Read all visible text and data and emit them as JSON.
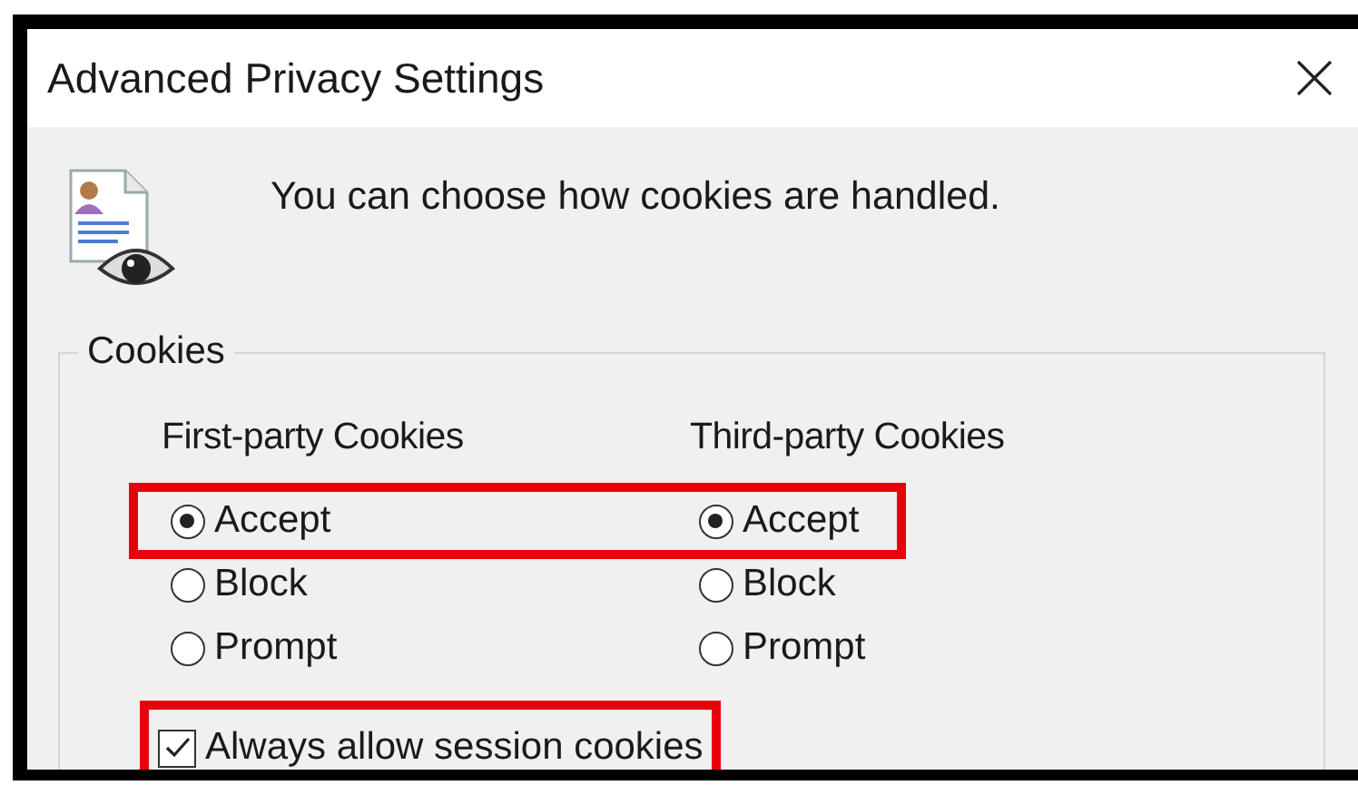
{
  "window": {
    "title": "Advanced Privacy Settings"
  },
  "message": "You can choose how cookies are handled.",
  "cookies": {
    "legend": "Cookies",
    "column_headings": [
      "First-party Cookies",
      "Third-party Cookies"
    ],
    "rows": [
      {
        "highlighted": true,
        "options": [
          {
            "label": "Accept",
            "selected": true
          },
          {
            "label": "Accept",
            "selected": true
          }
        ]
      },
      {
        "highlighted": false,
        "options": [
          {
            "label": "Block",
            "selected": false
          },
          {
            "label": "Block",
            "selected": false
          }
        ]
      },
      {
        "highlighted": false,
        "options": [
          {
            "label": "Prompt",
            "selected": false
          },
          {
            "label": "Prompt",
            "selected": false
          }
        ]
      }
    ],
    "session_checkbox": {
      "label": "Always allow session cookies",
      "checked": true,
      "highlighted": true
    }
  }
}
